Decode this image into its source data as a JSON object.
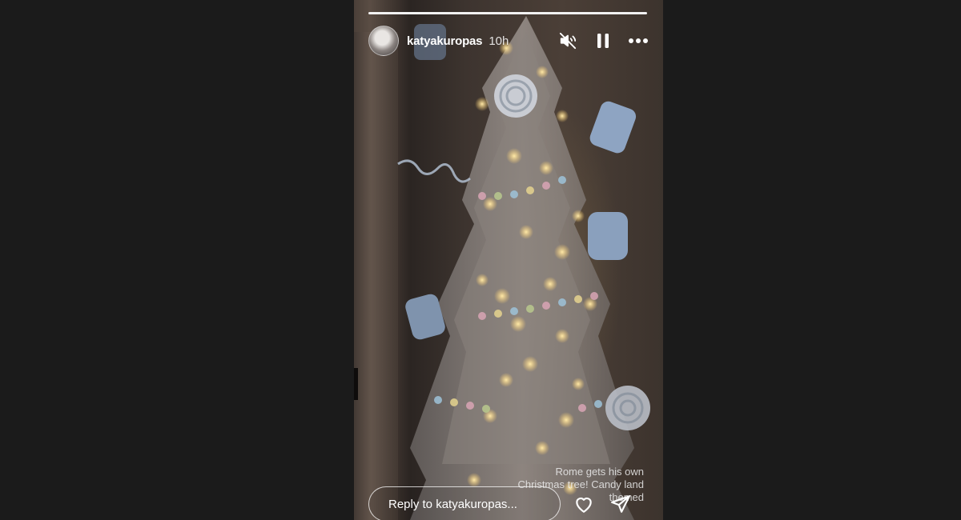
{
  "story": {
    "username": "katyakuropas",
    "time_ago": "10h",
    "progress_fraction": 1.0,
    "caption": "Rome gets his own Christmas tree! Candy land themed",
    "reply_placeholder": "Reply to katyakuropas..."
  },
  "icons": {
    "mute": "speaker-muted-icon",
    "pause": "pause-icon",
    "more": "more-horizontal-icon",
    "like": "heart-icon",
    "share": "send-icon"
  },
  "colors": {
    "page_background": "#1b1b1b",
    "text": "#ffffff"
  }
}
